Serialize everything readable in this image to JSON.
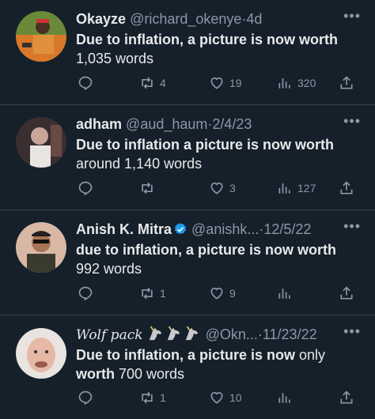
{
  "tweets": [
    {
      "name": "Okayze",
      "handle": "@richard_okenye",
      "separator": "·",
      "date": "4d",
      "text_bold": "Due to inflation, a picture is now worth",
      "text_normal": "1,035 words",
      "replies": "",
      "retweets": "4",
      "likes": "19",
      "views": "320"
    },
    {
      "name": "adham",
      "handle": "@aud_haum",
      "separator": "·",
      "date": "2/4/23",
      "text_bold": "Due to inflation a picture is now worth",
      "text_normal": "around 1,140 words",
      "replies": "",
      "retweets": "",
      "likes": "3",
      "views": "127"
    },
    {
      "name": "Anish K. Mitra",
      "handle": "@anishk...",
      "separator": "·",
      "date": "12/5/22",
      "text_bold": "due to inflation, a picture is now worth",
      "text_normal": "992 words",
      "replies": "",
      "retweets": "1",
      "likes": "9",
      "views": ""
    },
    {
      "name": "Wolf pack",
      "handle": "@Okn...",
      "separator": "·",
      "date": "11/23/22",
      "text_bold_1": "Due to inflation, a picture is now",
      "text_normal_1": " only",
      "text_bold_2": "worth",
      "text_normal_2": " 700 words",
      "replies": "",
      "retweets": "1",
      "likes": "10",
      "views": ""
    }
  ],
  "more_label": "•••",
  "colors": {
    "background": "#15202b",
    "secondary_text": "#8b98a5",
    "verified": "#1d9bf0"
  },
  "icons": [
    "reply-icon",
    "retweet-icon",
    "like-icon",
    "views-icon",
    "share-icon",
    "verified-icon",
    "unicorn-icon"
  ]
}
